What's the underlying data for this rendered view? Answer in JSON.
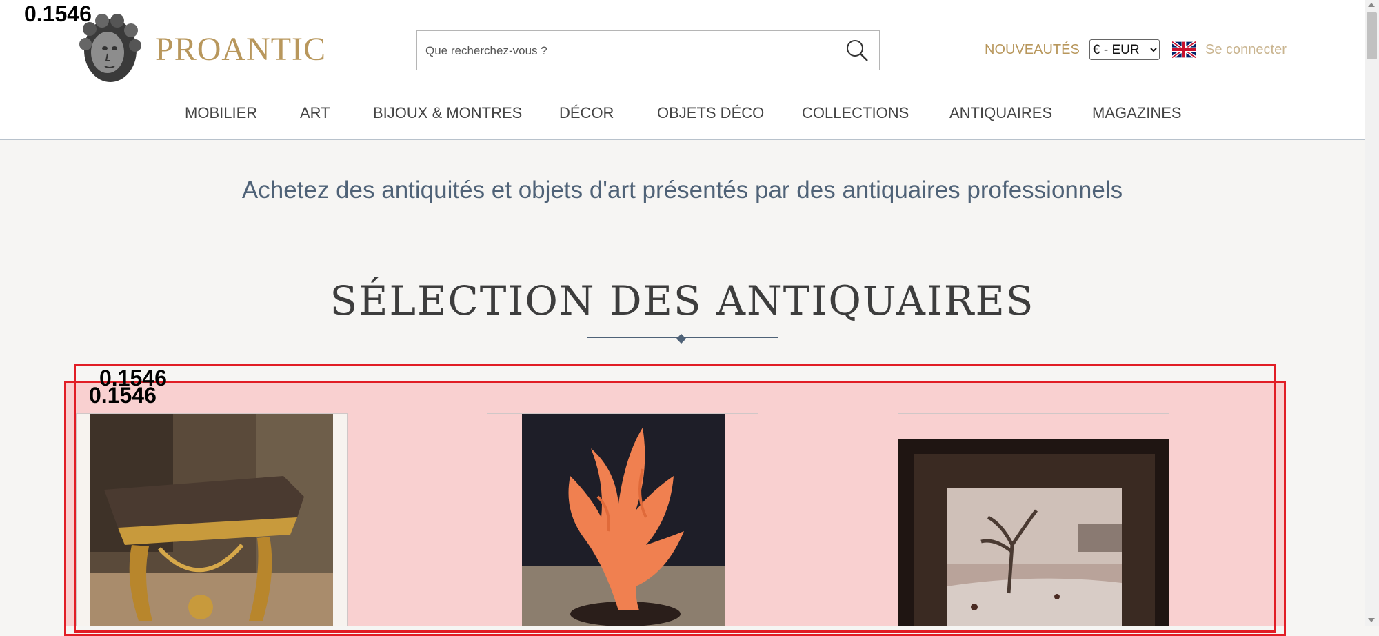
{
  "header": {
    "brand": "PROANTIC",
    "search_placeholder": "Que recherchez-vous ?",
    "new_label": "NOUVEAUTÉS",
    "currency": {
      "selected": "€ - EUR"
    },
    "login_label": "Se connecter",
    "flag_icon": "uk-flag-icon"
  },
  "nav": {
    "items": [
      {
        "label": "MOBILIER"
      },
      {
        "label": "ART"
      },
      {
        "label": "BIJOUX & MONTRES"
      },
      {
        "label": "DÉCOR"
      },
      {
        "label": "OBJETS DÉCO"
      },
      {
        "label": "COLLECTIONS"
      },
      {
        "label": "ANTIQUAIRES"
      },
      {
        "label": "MAGAZINES"
      }
    ]
  },
  "main": {
    "tagline": "Achetez des antiquités et objets d'art présentés par des antiquaires professionnels",
    "section_title": "SÉLECTION DES ANTIQUAIRES"
  },
  "overlay": {
    "scores": [
      "0.1546",
      "0.1546",
      "0.1546"
    ]
  },
  "colors": {
    "brand_gold": "#b8975c",
    "text_blue": "#4f6277",
    "highlight_red": "#e11d25",
    "highlight_fill": "#f9d0d0"
  }
}
